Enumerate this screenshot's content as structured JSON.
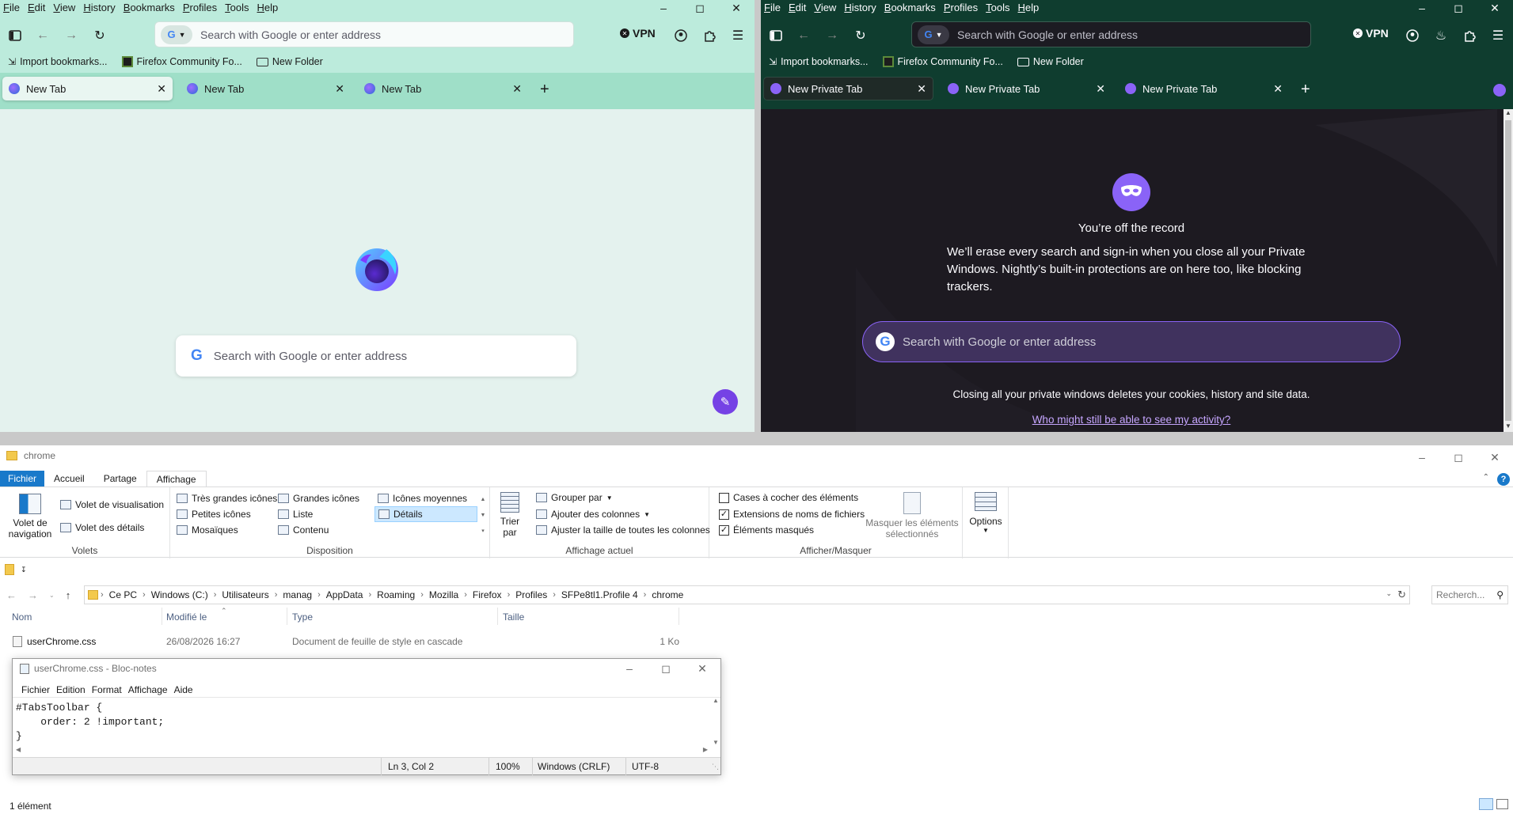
{
  "colors": {
    "ff_light_bg": "#e4f2ee",
    "ff_light_titlebar": "#bcebdc",
    "ff_light_tabstrip": "#9fdfc8",
    "ff_dark_bg": "#1d1a21",
    "ff_dark_titlebar": "#0f3d2f",
    "ff_dark_tabstrip": "#0f3d2f",
    "private_accent": "#6a4bd2",
    "private_search_bg": "#40325e",
    "explorer_accent": "#1979ca",
    "link_purple": "#c6a6ff"
  },
  "firefox_light": {
    "menu": [
      "File",
      "Edit",
      "View",
      "History",
      "Bookmarks",
      "Profiles",
      "Tools",
      "Help"
    ],
    "window_controls": [
      "minimize-icon",
      "maximize-icon",
      "close-icon"
    ],
    "url_placeholder": "Search with Google or enter address",
    "vpn_label": "VPN",
    "bookmarks": [
      {
        "label": "Import bookmarks...",
        "icon": "import-icon"
      },
      {
        "label": "Firefox Community Fo...",
        "icon": "community-favicon"
      },
      {
        "label": "New Folder",
        "icon": "folder-icon"
      }
    ],
    "tabs": [
      {
        "label": "New Tab",
        "active": true
      },
      {
        "label": "New Tab",
        "active": false
      },
      {
        "label": "New Tab",
        "active": false
      }
    ],
    "content_search_placeholder": "Search with Google or enter address"
  },
  "firefox_private": {
    "menu": [
      "File",
      "Edit",
      "View",
      "History",
      "Bookmarks",
      "Profiles",
      "Tools",
      "Help"
    ],
    "url_placeholder": "Search with Google or enter address",
    "vpn_label": "VPN",
    "bookmarks": [
      {
        "label": "Import bookmarks...",
        "icon": "import-icon"
      },
      {
        "label": "Firefox Community Fo...",
        "icon": "community-favicon"
      },
      {
        "label": "New Folder",
        "icon": "folder-icon"
      }
    ],
    "tabs": [
      {
        "label": "New Private Tab",
        "active": true
      },
      {
        "label": "New Private Tab",
        "active": false
      },
      {
        "label": "New Private Tab",
        "active": false
      }
    ],
    "heading": "You’re off the record",
    "body": "We’ll erase every search and sign-in when you close all your Private Windows. Nightly’s built-in protections are on here too, like blocking trackers.",
    "search_placeholder": "Search with Google or enter address",
    "footer_note": "Closing all your private windows deletes your cookies, history and site data.",
    "footer_link": "Who might still be able to see my activity?"
  },
  "explorer": {
    "title": "chrome",
    "ribbon_tabs": [
      "Fichier",
      "Accueil",
      "Partage",
      "Affichage"
    ],
    "active_tab": "Affichage",
    "volets": {
      "nav_pane_line1": "Volet de",
      "nav_pane_line2": "navigation",
      "preview_pane": "Volet de visualisation",
      "details_pane": "Volet des détails",
      "group_label": "Volets"
    },
    "disposition": {
      "items": [
        "Très grandes icônes",
        "Grandes icônes",
        "Icônes moyennes",
        "Petites icônes",
        "Liste",
        "Détails",
        "Mosaïques",
        "Contenu"
      ],
      "selected": "Détails",
      "group_label": "Disposition"
    },
    "affichage_actuel": {
      "sort_line1": "Trier",
      "sort_line2": "par",
      "group_by": "Grouper par",
      "add_columns": "Ajouter des colonnes",
      "fit_columns": "Ajuster la taille de toutes les colonnes",
      "group_label": "Affichage actuel"
    },
    "afficher_masquer": {
      "checkboxes": [
        {
          "label": "Cases à cocher des éléments",
          "checked": false
        },
        {
          "label": "Extensions de noms de fichiers",
          "checked": true
        },
        {
          "label": "Éléments masqués",
          "checked": true
        }
      ],
      "hide_selected_line1": "Masquer les éléments",
      "hide_selected_line2": "sélectionnés",
      "group_label": "Afficher/Masquer"
    },
    "options_label": "Options",
    "breadcrumb": [
      "Ce PC",
      "Windows (C:)",
      "Utilisateurs",
      "manag",
      "AppData",
      "Roaming",
      "Mozilla",
      "Firefox",
      "Profiles",
      "SFPe8tl1.Profile 4",
      "chrome"
    ],
    "search_placeholder": "Recherch...",
    "columns": [
      "Nom",
      "Modifié le",
      "Type",
      "Taille"
    ],
    "files": [
      {
        "name": "userChrome.css",
        "modified": "26/08/2026 16:27",
        "type": "Document de feuille de style en cascade",
        "size": "1 Ko"
      }
    ],
    "status": "1 élément"
  },
  "notepad": {
    "title": "userChrome.css - Bloc-notes",
    "menu": [
      "Fichier",
      "Edition",
      "Format",
      "Affichage",
      "Aide"
    ],
    "content_lines": [
      "#TabsToolbar {",
      "    order: 2 !important;",
      "}"
    ],
    "status": {
      "position": "Ln 3, Col 2",
      "zoom": "100%",
      "line_ending": "Windows (CRLF)",
      "encoding": "UTF-8"
    }
  }
}
